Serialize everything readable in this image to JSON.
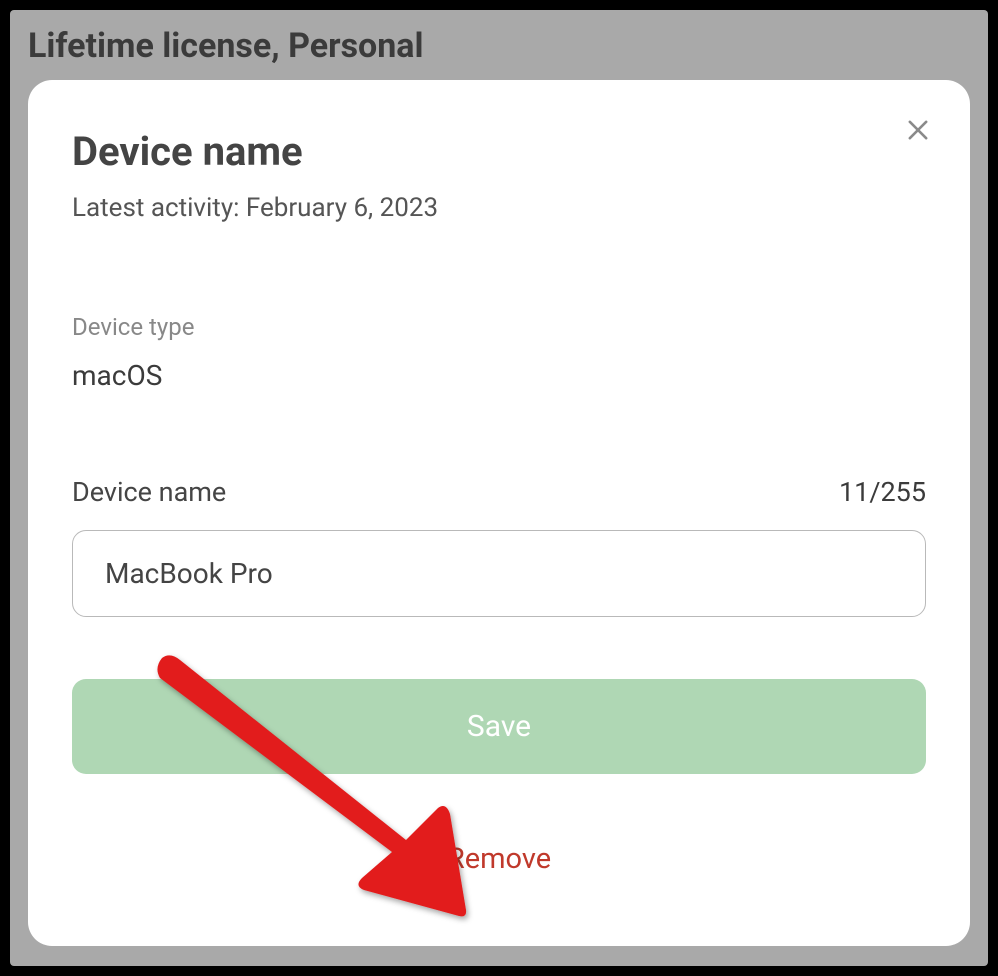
{
  "page": {
    "title": "Lifetime license, Personal"
  },
  "modal": {
    "title": "Device name",
    "latest_activity_label": "Latest activity:",
    "latest_activity_date": "February 6, 2023",
    "device_type_label": "Device type",
    "device_type_value": "macOS",
    "device_name_label": "Device name",
    "char_count": "11/255",
    "device_name_value": "MacBook Pro",
    "save_label": "Save",
    "remove_label": "Remove"
  }
}
